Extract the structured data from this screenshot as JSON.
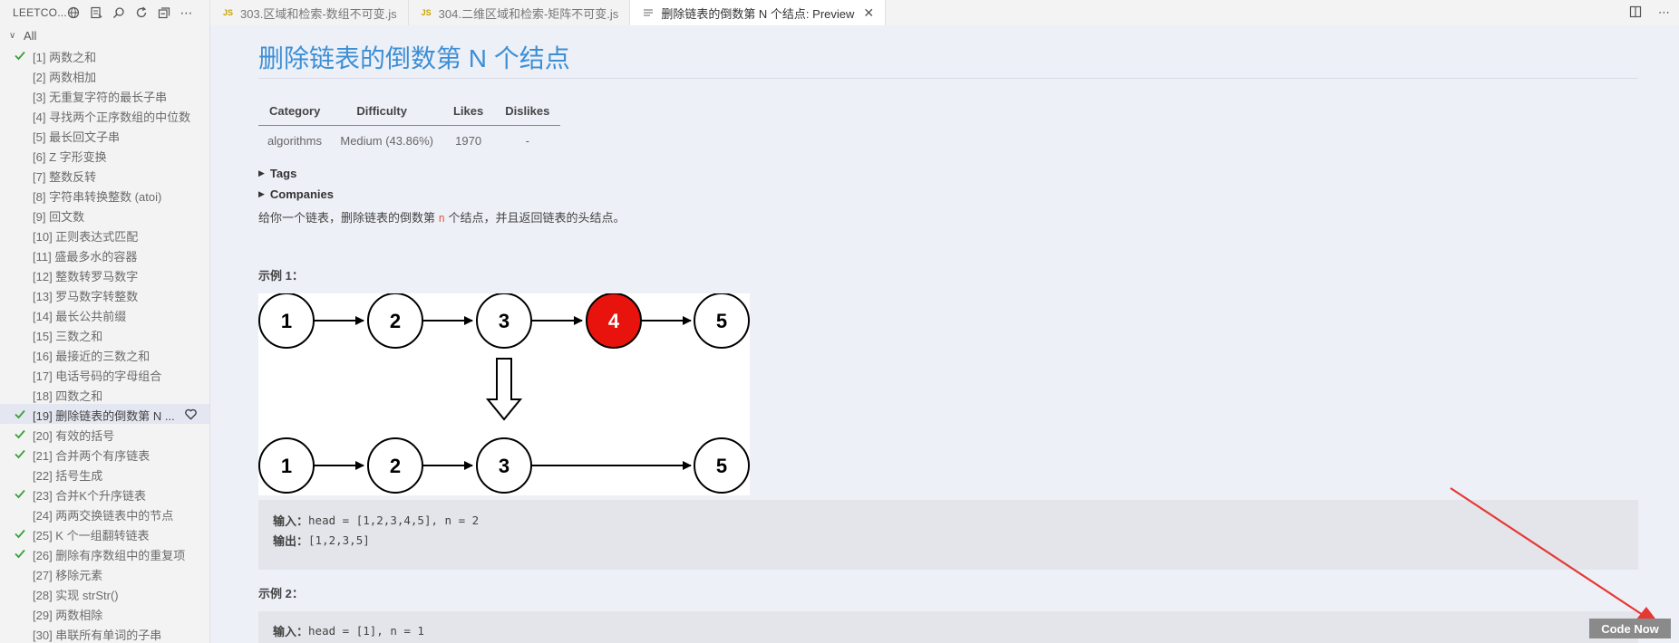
{
  "sidebar": {
    "header": {
      "title": "LEETCO..."
    },
    "root_label": "All",
    "items": [
      {
        "label": "[1] 两数之和",
        "solved": true,
        "selected": false
      },
      {
        "label": "[2] 两数相加",
        "solved": false,
        "selected": false
      },
      {
        "label": "[3] 无重复字符的最长子串",
        "solved": false,
        "selected": false
      },
      {
        "label": "[4] 寻找两个正序数组的中位数",
        "solved": false,
        "selected": false
      },
      {
        "label": "[5] 最长回文子串",
        "solved": false,
        "selected": false
      },
      {
        "label": "[6] Z 字形变换",
        "solved": false,
        "selected": false
      },
      {
        "label": "[7] 整数反转",
        "solved": false,
        "selected": false
      },
      {
        "label": "[8] 字符串转换整数 (atoi)",
        "solved": false,
        "selected": false
      },
      {
        "label": "[9] 回文数",
        "solved": false,
        "selected": false
      },
      {
        "label": "[10] 正则表达式匹配",
        "solved": false,
        "selected": false
      },
      {
        "label": "[11] 盛最多水的容器",
        "solved": false,
        "selected": false
      },
      {
        "label": "[12] 整数转罗马数字",
        "solved": false,
        "selected": false
      },
      {
        "label": "[13] 罗马数字转整数",
        "solved": false,
        "selected": false
      },
      {
        "label": "[14] 最长公共前缀",
        "solved": false,
        "selected": false
      },
      {
        "label": "[15] 三数之和",
        "solved": false,
        "selected": false
      },
      {
        "label": "[16] 最接近的三数之和",
        "solved": false,
        "selected": false
      },
      {
        "label": "[17] 电话号码的字母组合",
        "solved": false,
        "selected": false
      },
      {
        "label": "[18] 四数之和",
        "solved": false,
        "selected": false
      },
      {
        "label": "[19] 删除链表的倒数第 N ...",
        "solved": true,
        "selected": true
      },
      {
        "label": "[20] 有效的括号",
        "solved": true,
        "selected": false
      },
      {
        "label": "[21] 合并两个有序链表",
        "solved": true,
        "selected": false
      },
      {
        "label": "[22] 括号生成",
        "solved": false,
        "selected": false
      },
      {
        "label": "[23] 合并K个升序链表",
        "solved": true,
        "selected": false
      },
      {
        "label": "[24] 两两交换链表中的节点",
        "solved": false,
        "selected": false
      },
      {
        "label": "[25] K 个一组翻转链表",
        "solved": true,
        "selected": false
      },
      {
        "label": "[26] 删除有序数组中的重复项",
        "solved": true,
        "selected": false
      },
      {
        "label": "[27] 移除元素",
        "solved": false,
        "selected": false
      },
      {
        "label": "[28] 实现 strStr()",
        "solved": false,
        "selected": false
      },
      {
        "label": "[29] 两数相除",
        "solved": false,
        "selected": false
      },
      {
        "label": "[30] 串联所有单词的子串",
        "solved": false,
        "selected": false
      }
    ]
  },
  "tabs": [
    {
      "label": "303.区域和检索-数组不可变.js",
      "type": "js",
      "active": false
    },
    {
      "label": "304.二维区域和检索-矩阵不可变.js",
      "type": "js",
      "active": false
    },
    {
      "label": "删除链表的倒数第 N 个结点: Preview",
      "type": "preview",
      "active": true
    }
  ],
  "problem": {
    "title": "删除链表的倒数第 N 个结点",
    "table": {
      "headers": [
        "Category",
        "Difficulty",
        "Likes",
        "Dislikes"
      ],
      "row": [
        "algorithms",
        "Medium (43.86%)",
        "1970",
        "-"
      ]
    },
    "tags_label": "Tags",
    "companies_label": "Companies",
    "desc_before": "给你一个链表，删除链表的倒数第 ",
    "desc_code": "n",
    "desc_after": " 个结点，并且返回链表的头结点。",
    "example1_title": "示例 1：",
    "diagram": {
      "top_nodes": [
        "1",
        "2",
        "3",
        "4",
        "5"
      ],
      "bottom_nodes": [
        "1",
        "2",
        "3",
        "5"
      ],
      "highlight_color": "#e8130c"
    },
    "example1": {
      "input_key": "输入：",
      "input_value": "head = [1,2,3,4,5], n = 2",
      "output_key": "输出：",
      "output_value": "[1,2,3,5]"
    },
    "example2_title": "示例 2：",
    "example2": {
      "input_key": "输入：",
      "input_value": "head = [1], n = 1"
    }
  },
  "code_now_label": "Code Now",
  "colors": {
    "accent": "#3c8fd6",
    "check": "#3aa03a",
    "annotation_arrow": "#e53935"
  }
}
